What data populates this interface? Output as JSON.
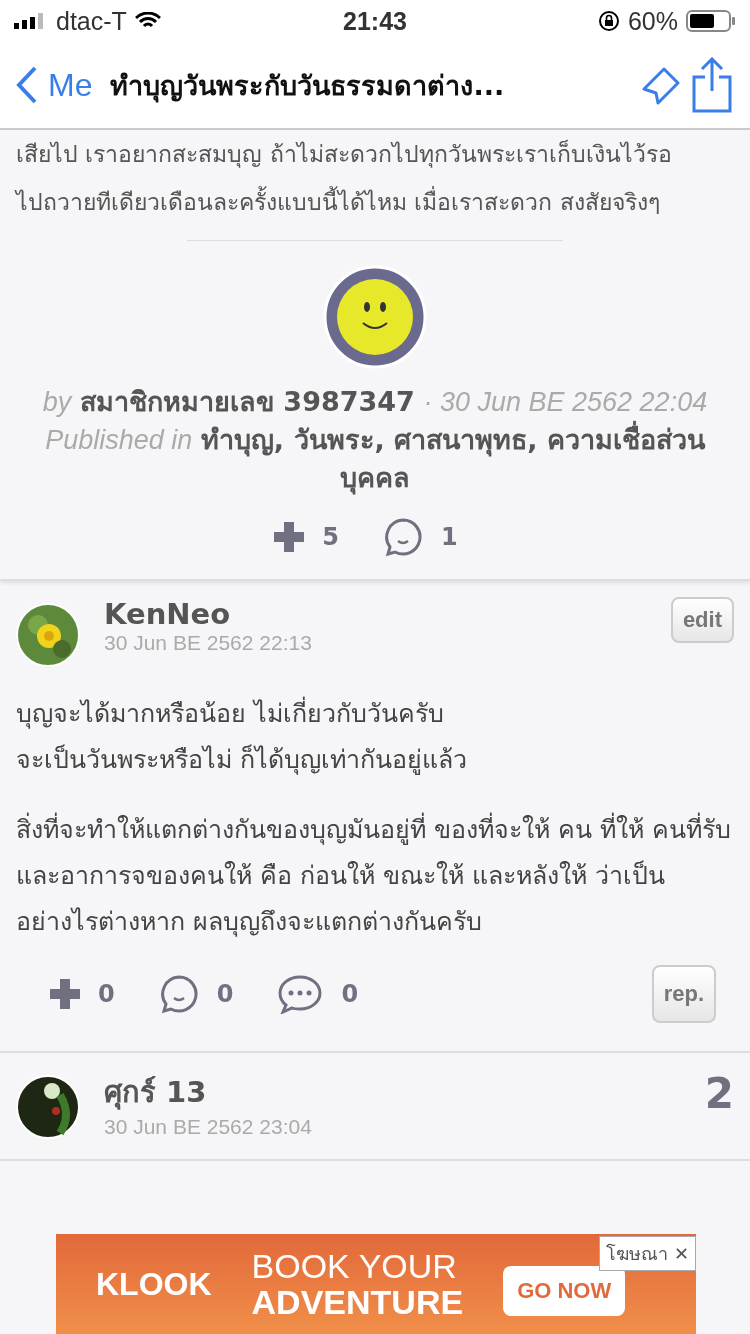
{
  "status_bar": {
    "carrier": "dtac-T",
    "time": "21:43",
    "battery": "60%"
  },
  "nav": {
    "back": "Me",
    "title": "ทำบุญวันพระกับวันธรรมดาต่าง..."
  },
  "post": {
    "text_lines": [
      "เสียไป เราอยากสะสมบุญ ถ้าไม่สะดวกไปทุกวันพระเราเก็บเงินไว้รอ",
      "ไปถวายทีเดียวเดือนละครั้งแบบนี้ได้ไหม เมื่อเราสะดวก สงสัยจริงๆ"
    ],
    "by_label": "by",
    "author": "สมาชิกหมายเลข 3987347",
    "date": "· 30 Jun BE 2562 22:04",
    "published_label": "Published in",
    "tags": "ทำบุญ, วันพระ, ศาสนาพุทธ, ความเชื่อส่วนบุคคล",
    "plus_count": "5",
    "comment_count": "1"
  },
  "comments": [
    {
      "name": "KenNeo",
      "date": "30 Jun BE 2562 22:13",
      "edit": "edit",
      "paragraphs": [
        "บุญจะได้มากหรือน้อย ไม่เกี่ยวกับวันครับ\nจะเป็นวันพระหรือไม่ ก็ได้บุญเท่ากันอยู่แล้ว",
        "สิ่งที่จะทำให้แตกต่างกันของบุญมันอยู่ที่ ของที่จะให้ คน ที่ให้ คนที่รับ และอาการจของคนให้ คือ ก่อนให้ ขณะให้ และหลังให้ ว่าเป็นอย่างไรต่างหาก ผลบุญถึงจะแตกต่างกันครับ"
      ],
      "plus": "0",
      "replies": "0",
      "more": "0",
      "reply_button": "rep."
    },
    {
      "name": "ศุกร์ 13",
      "date": "30 Jun BE 2562 23:04",
      "number": "2"
    }
  ],
  "ad": {
    "brand": "KLOOK",
    "line1": "BOOK YOUR",
    "line2": "ADVENTURE",
    "cta": "GO NOW",
    "label": "โฆษณา",
    "close": "✕"
  }
}
